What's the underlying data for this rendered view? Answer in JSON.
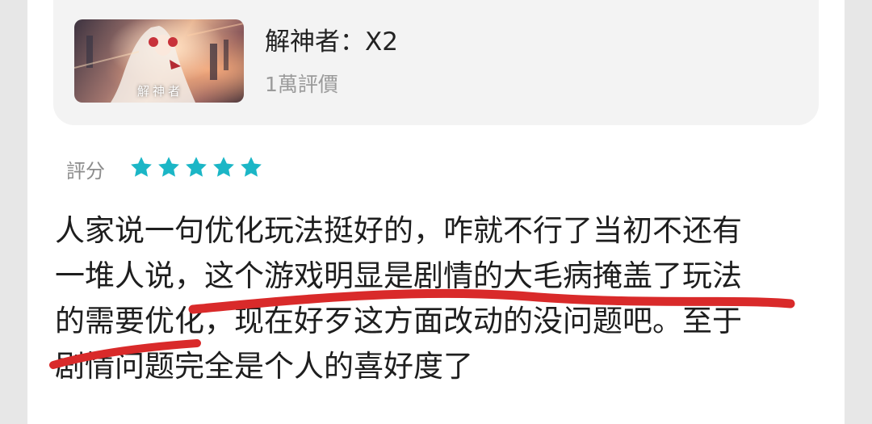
{
  "game": {
    "title": "解神者：X2",
    "review_count": "1萬評價",
    "cover_text": "解神者"
  },
  "rating": {
    "label": "評分",
    "stars": 5,
    "max_stars": 5,
    "star_color": "#1bb6c6"
  },
  "review": {
    "lines": [
      "人家说一句优化玩法挺好的，咋就不行了当初不还有",
      "一堆人说，这个游戏明显是剧情的大毛病掩盖了玩法",
      "的需要优化，现在好歹这方面改动的没问题吧。至于",
      "剧情问题完全是个人的喜好度了"
    ]
  },
  "annotation": {
    "color": "#d92a2a"
  }
}
